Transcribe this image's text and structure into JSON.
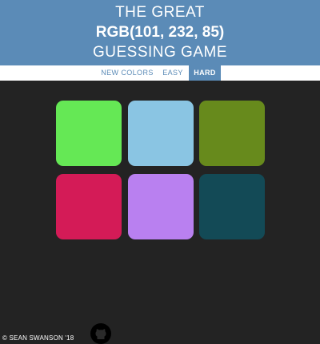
{
  "header": {
    "line1": "THE GREAT",
    "line2": "RGB(101, 232, 85)",
    "line3": "GUESSING GAME",
    "bg_color": "#5b8bb7"
  },
  "controls": {
    "new_colors": "NEW COLORS",
    "easy": "EASY",
    "hard": "HARD",
    "selected_mode": "HARD"
  },
  "squares": [
    {
      "color": "#65e855"
    },
    {
      "color": "#8ac5e3"
    },
    {
      "color": "#678a1c"
    },
    {
      "color": "#d41b57"
    },
    {
      "color": "#b980f0"
    },
    {
      "color": "#134a56"
    }
  ],
  "footer": {
    "copyright": "© SEAN SWANSON  '18",
    "icon": "github-icon"
  },
  "colors": {
    "background": "#232323",
    "accent": "#5b8bb7"
  }
}
